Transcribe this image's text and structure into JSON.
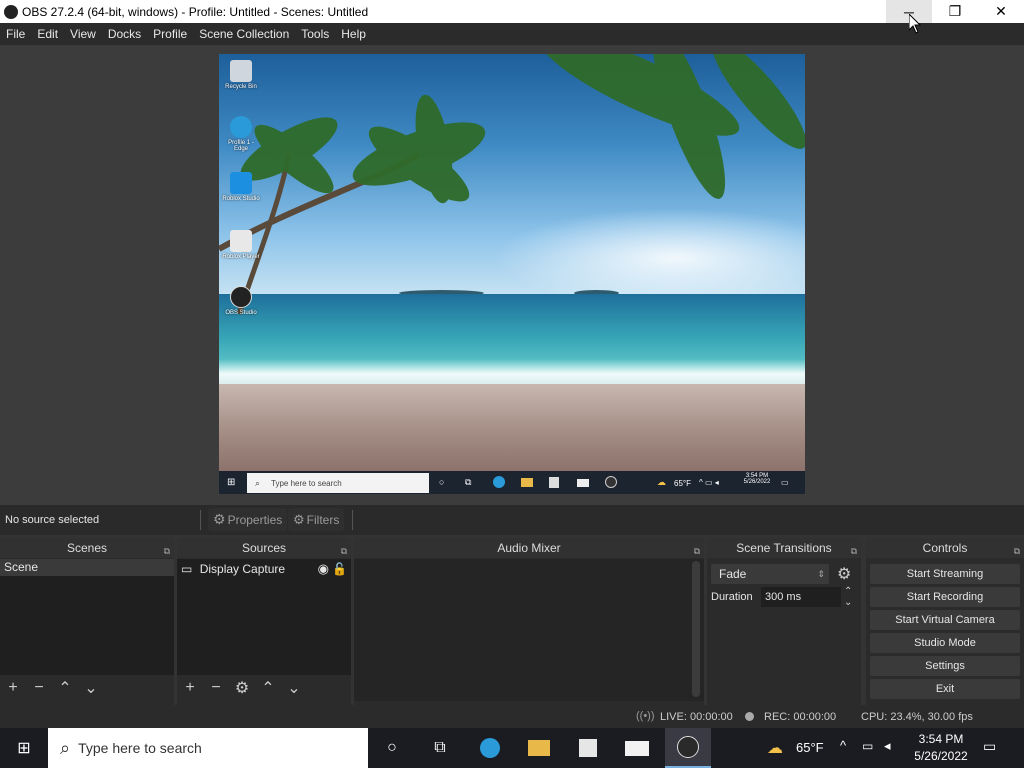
{
  "window": {
    "title": "OBS 27.2.4 (64-bit, windows) - Profile: Untitled - Scenes: Untitled"
  },
  "menu": [
    "File",
    "Edit",
    "View",
    "Docks",
    "Profile",
    "Scene Collection",
    "Tools",
    "Help"
  ],
  "preview": {
    "desktop_icons": [
      "Recycle Bin",
      "Profile 1 - Edge",
      "Roblox Studio",
      "Roblox Player",
      "OBS Studio"
    ],
    "search_placeholder": "Type here to search",
    "weather": "65°F",
    "time": "3:54 PM",
    "date": "5/26/2022"
  },
  "source_toolbar": {
    "no_source": "No source selected",
    "properties": "Properties",
    "filters": "Filters"
  },
  "docks": {
    "scenes": {
      "title": "Scenes",
      "items": [
        "Scene"
      ]
    },
    "sources": {
      "title": "Sources",
      "items": [
        "Display Capture"
      ]
    },
    "audio": {
      "title": "Audio Mixer"
    },
    "transitions": {
      "title": "Scene Transitions",
      "transition": "Fade",
      "duration_label": "Duration",
      "duration": "300 ms"
    },
    "controls": {
      "title": "Controls",
      "buttons": [
        "Start Streaming",
        "Start Recording",
        "Start Virtual Camera",
        "Studio Mode",
        "Settings",
        "Exit"
      ]
    }
  },
  "status": {
    "live": "LIVE: 00:00:00",
    "rec": "REC: 00:00:00",
    "cpu": "CPU: 23.4%, 30.00 fps"
  },
  "taskbar": {
    "search_placeholder": "Type here to search",
    "weather": "65°F",
    "time": "3:54 PM",
    "date": "5/26/2022"
  }
}
